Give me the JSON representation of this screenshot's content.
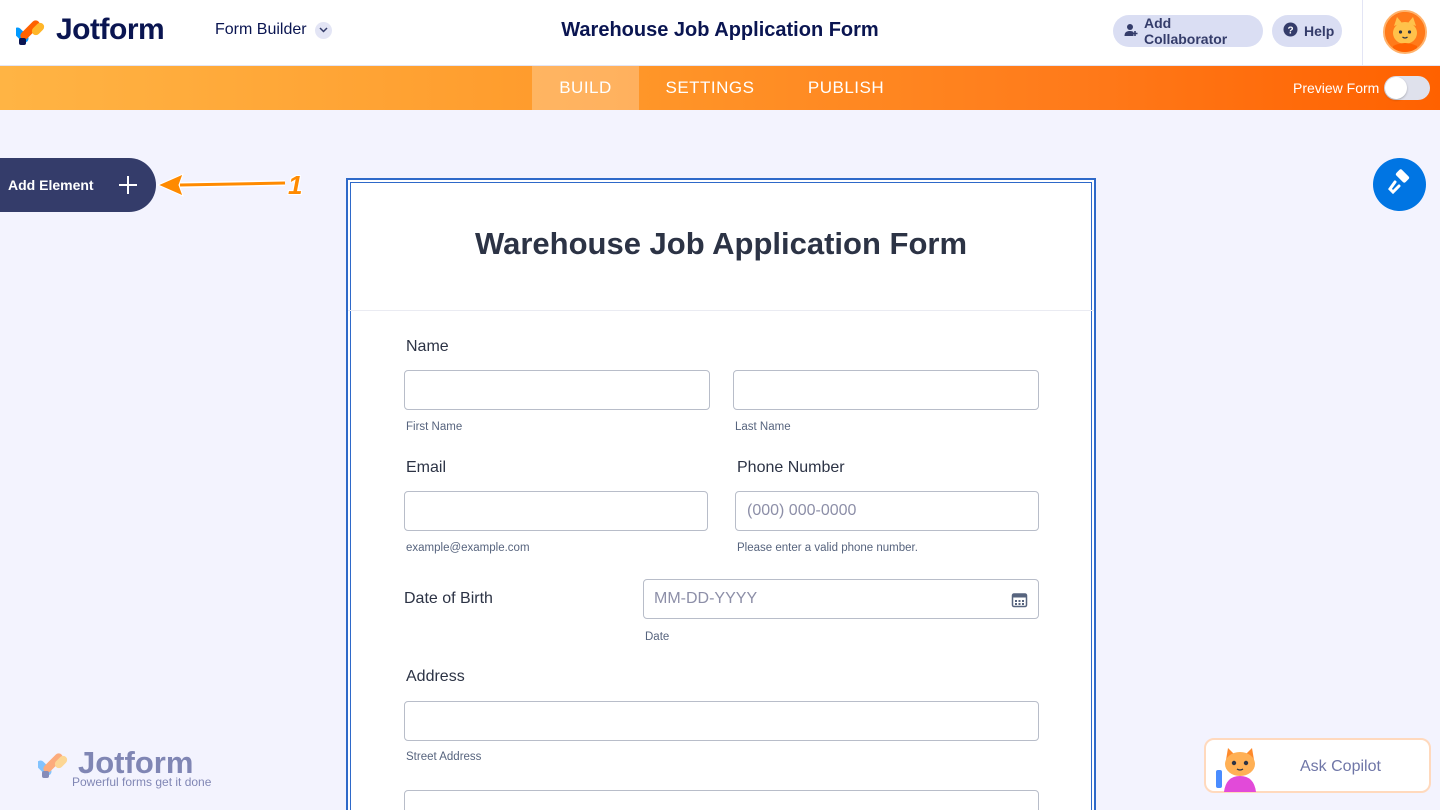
{
  "header": {
    "brand": "Jotform",
    "builder_menu": "Form Builder",
    "form_title": "Warehouse Job Application Form",
    "add_collaborator": "Add Collaborator",
    "help": "Help"
  },
  "nav": {
    "tabs": [
      "BUILD",
      "SETTINGS",
      "PUBLISH"
    ],
    "active_tab": "BUILD",
    "preview_label": "Preview Form",
    "preview_on": false
  },
  "sidebar": {
    "add_element": "Add Element",
    "annotation_number": "1"
  },
  "form": {
    "title": "Warehouse Job Application Form",
    "name": {
      "label": "Name",
      "first_sublabel": "First Name",
      "last_sublabel": "Last Name",
      "first_value": "",
      "last_value": ""
    },
    "email": {
      "label": "Email",
      "sublabel": "example@example.com",
      "value": ""
    },
    "phone": {
      "label": "Phone Number",
      "placeholder": "(000) 000-0000",
      "sublabel": "Please enter a valid phone number."
    },
    "dob": {
      "label": "Date of Birth",
      "placeholder": "MM-DD-YYYY",
      "sublabel": "Date"
    },
    "address": {
      "label": "Address",
      "street_sublabel": "Street Address",
      "street_value": ""
    }
  },
  "footer": {
    "brand": "Jotform",
    "tagline": "Powerful forms get it done"
  },
  "copilot": {
    "label": "Ask Copilot"
  },
  "colors": {
    "navy": "#0a1551",
    "orange": "#ff6100",
    "blue": "#0075e3",
    "form_border": "#2e69c9"
  },
  "icons": [
    "jotform-logo-icon",
    "chevron-down-icon",
    "add-user-icon",
    "help-icon",
    "plus-icon",
    "arrow-icon",
    "paint-roller-icon",
    "calendar-icon",
    "copilot-cat-icon"
  ]
}
